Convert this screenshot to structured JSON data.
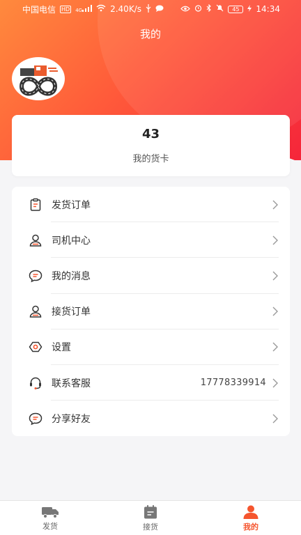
{
  "status_bar": {
    "carrier": "中国电信",
    "hd_badge": "HD",
    "net_type": "4G",
    "speed": "2.40K/s",
    "battery": "45",
    "time": "14:34"
  },
  "header": {
    "title": "我的"
  },
  "stats": {
    "value": "43",
    "label": "我的货卡"
  },
  "menu": {
    "items": [
      {
        "label": "发货订单",
        "icon": "clipboard-icon"
      },
      {
        "label": "司机中心",
        "icon": "driver-icon"
      },
      {
        "label": "我的消息",
        "icon": "message-icon"
      },
      {
        "label": "接货订单",
        "icon": "driver-icon"
      },
      {
        "label": "设置",
        "icon": "hexagon-settings-icon"
      },
      {
        "label": "联系客服",
        "icon": "headset-icon",
        "extra": "17778339914"
      },
      {
        "label": "分享好友",
        "icon": "share-chat-icon"
      }
    ]
  },
  "tabbar": {
    "tabs": [
      {
        "label": "发货",
        "icon": "truck-icon"
      },
      {
        "label": "接货",
        "icon": "calendar-icon"
      },
      {
        "label": "我的",
        "icon": "person-icon",
        "active": true
      }
    ]
  },
  "colors": {
    "accent": "#f5552e",
    "gradient_start": "#ff8a3d",
    "gradient_end": "#f5253a"
  }
}
